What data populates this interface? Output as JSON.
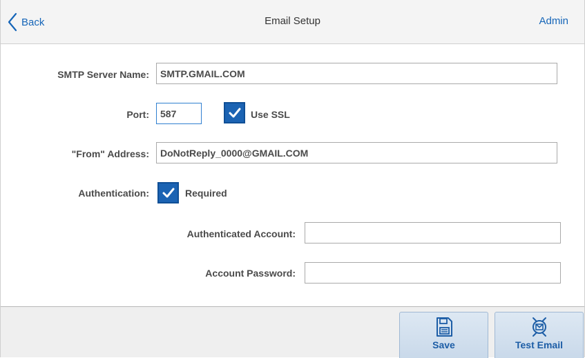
{
  "header": {
    "back_label": "Back",
    "title": "Email Setup",
    "user": "Admin"
  },
  "form": {
    "smtp_server": {
      "label": "SMTP Server Name:",
      "value": "SMTP.GMAIL.COM"
    },
    "port": {
      "label": "Port:",
      "value": "587"
    },
    "use_ssl": {
      "label": "Use SSL",
      "checked": true
    },
    "from_address": {
      "label": "\"From\" Address:",
      "value": "DoNotReply_0000@GMAIL.COM"
    },
    "authentication": {
      "label": "Authentication:",
      "checkbox_label": "Required",
      "checked": true
    },
    "authenticated_account": {
      "label": "Authenticated Account:",
      "value": ""
    },
    "account_password": {
      "label": "Account Password:",
      "value": ""
    }
  },
  "footer": {
    "save_label": "Save",
    "test_email_label": "Test Email"
  },
  "colors": {
    "accent": "#1565b8",
    "checkbox_fill": "#1b63b3",
    "button_text": "#1c5da6",
    "header_bg": "#f4f4f4"
  },
  "icons": {
    "back": "chevron-left-icon",
    "save": "floppy-disk-icon",
    "test_email": "envelope-target-icon",
    "check": "checkmark-icon"
  }
}
